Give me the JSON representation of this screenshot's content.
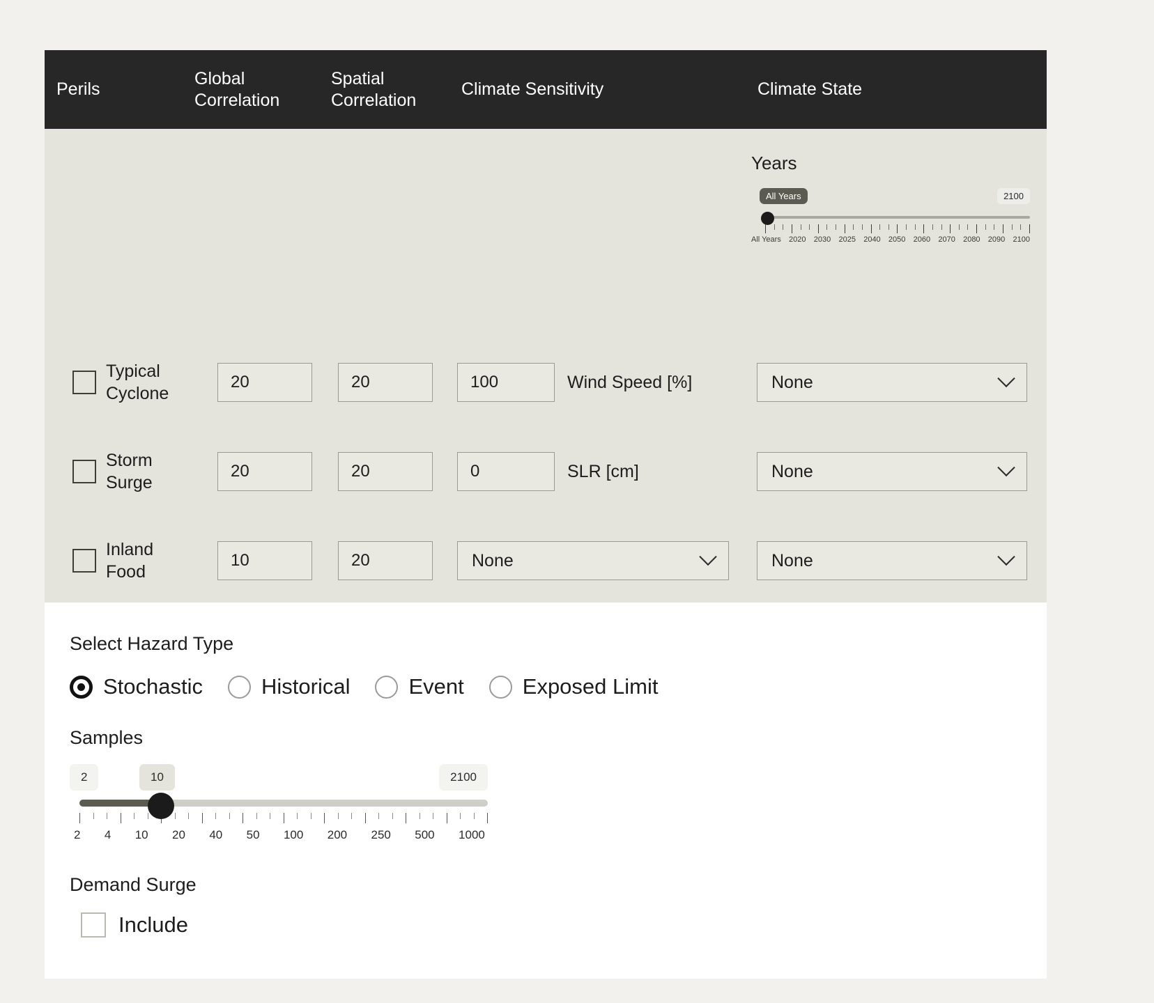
{
  "table": {
    "columns": [
      {
        "id": "perils",
        "label": "Perils"
      },
      {
        "id": "global_correlation",
        "label": "Global\nCorrelation"
      },
      {
        "id": "spatial_correlation",
        "label": "Spatial\nCorrelation"
      },
      {
        "id": "climate_sensitivity",
        "label": "Climate Sensitivity"
      },
      {
        "id": "climate_state",
        "label": "Climate State"
      }
    ]
  },
  "years": {
    "title": "Years",
    "selected_label": "All Years",
    "max_label": "2100",
    "tick_labels": [
      "All Years",
      "2020",
      "2030",
      "2025",
      "2040",
      "2050",
      "2060",
      "2070",
      "2080",
      "2090",
      "2100"
    ]
  },
  "perils": [
    {
      "name": "Typical\nCyclone",
      "checked": false,
      "global_correlation": "20",
      "spatial_correlation": "20",
      "sensitivity_value": "100",
      "sensitivity_unit": "Wind Speed [%]",
      "sensitivity_is_select": false,
      "climate_state": "None"
    },
    {
      "name": "Storm\nSurge",
      "checked": false,
      "global_correlation": "20",
      "spatial_correlation": "20",
      "sensitivity_value": "0",
      "sensitivity_unit": "SLR [cm]",
      "sensitivity_is_select": false,
      "climate_state": "None"
    },
    {
      "name": "Inland\nFood",
      "checked": false,
      "global_correlation": "10",
      "spatial_correlation": "20",
      "sensitivity_value": "None",
      "sensitivity_unit": "",
      "sensitivity_is_select": true,
      "climate_state": "None"
    }
  ],
  "hazard": {
    "title": "Select Hazard Type",
    "options": [
      {
        "label": "Stochastic",
        "selected": true
      },
      {
        "label": "Historical",
        "selected": false
      },
      {
        "label": "Event",
        "selected": false
      },
      {
        "label": "Exposed Limit",
        "selected": false
      }
    ]
  },
  "samples": {
    "title": "Samples",
    "min_chip": "2",
    "value_chip": "10",
    "max_chip": "2100",
    "tick_labels": [
      "2",
      "4",
      "10",
      "20",
      "40",
      "50",
      "100",
      "200",
      "250",
      "500",
      "1000"
    ]
  },
  "demand_surge": {
    "title": "Demand Surge",
    "include_label": "Include",
    "included": false
  },
  "colors": {
    "header_bg": "#272727",
    "panel_bg": "#e4e3dc",
    "page_bg": "#f2f1ee",
    "accent": "#1b1b1b"
  }
}
